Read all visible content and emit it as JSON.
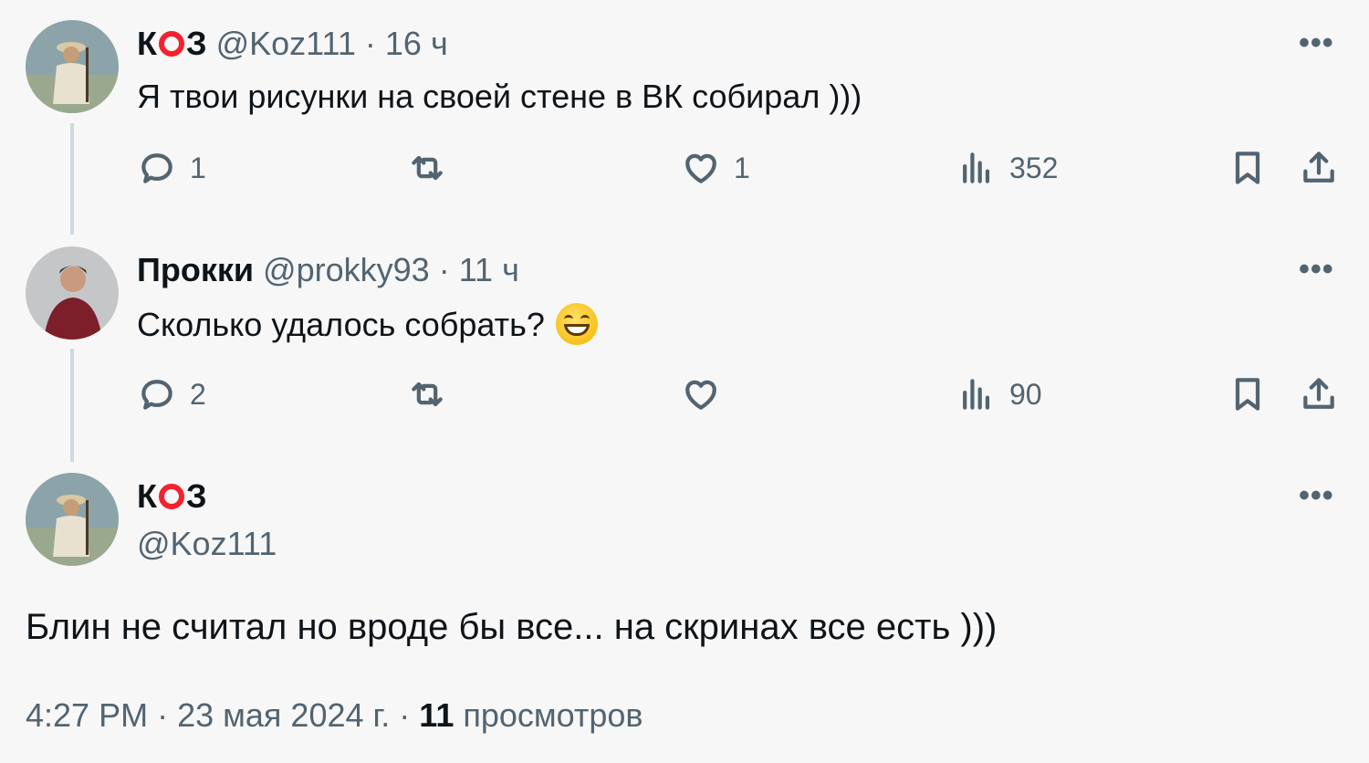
{
  "tweets": [
    {
      "name_prefix": "К",
      "name_suffix": "З",
      "handle": "@Koz111",
      "time": "16 ч",
      "text": "Я твои рисунки на своей стене в ВК собирал )))",
      "replies": "1",
      "retweets": "",
      "likes": "1",
      "views": "352"
    },
    {
      "name": "Прокки",
      "handle": "@prokky93",
      "time": "11 ч",
      "text": "Сколько удалось собрать?",
      "replies": "2",
      "retweets": "",
      "likes": "",
      "views": "90"
    }
  ],
  "main": {
    "name_prefix": "К",
    "name_suffix": "З",
    "handle": "@Koz111",
    "text": "Блин не считал но вроде бы все... на скринах все есть )))",
    "time": "4:27 PM",
    "date": "23 мая 2024 г.",
    "views_count": "11",
    "views_label": "просмотров"
  },
  "separator": "·",
  "more_label": "•••",
  "colors": {
    "accent_red": "#f4212e",
    "muted": "#536471",
    "thread_line": "#cfd9de"
  },
  "icons": [
    "reply-icon",
    "retweet-icon",
    "like-icon",
    "views-icon",
    "bookmark-icon",
    "share-icon"
  ]
}
